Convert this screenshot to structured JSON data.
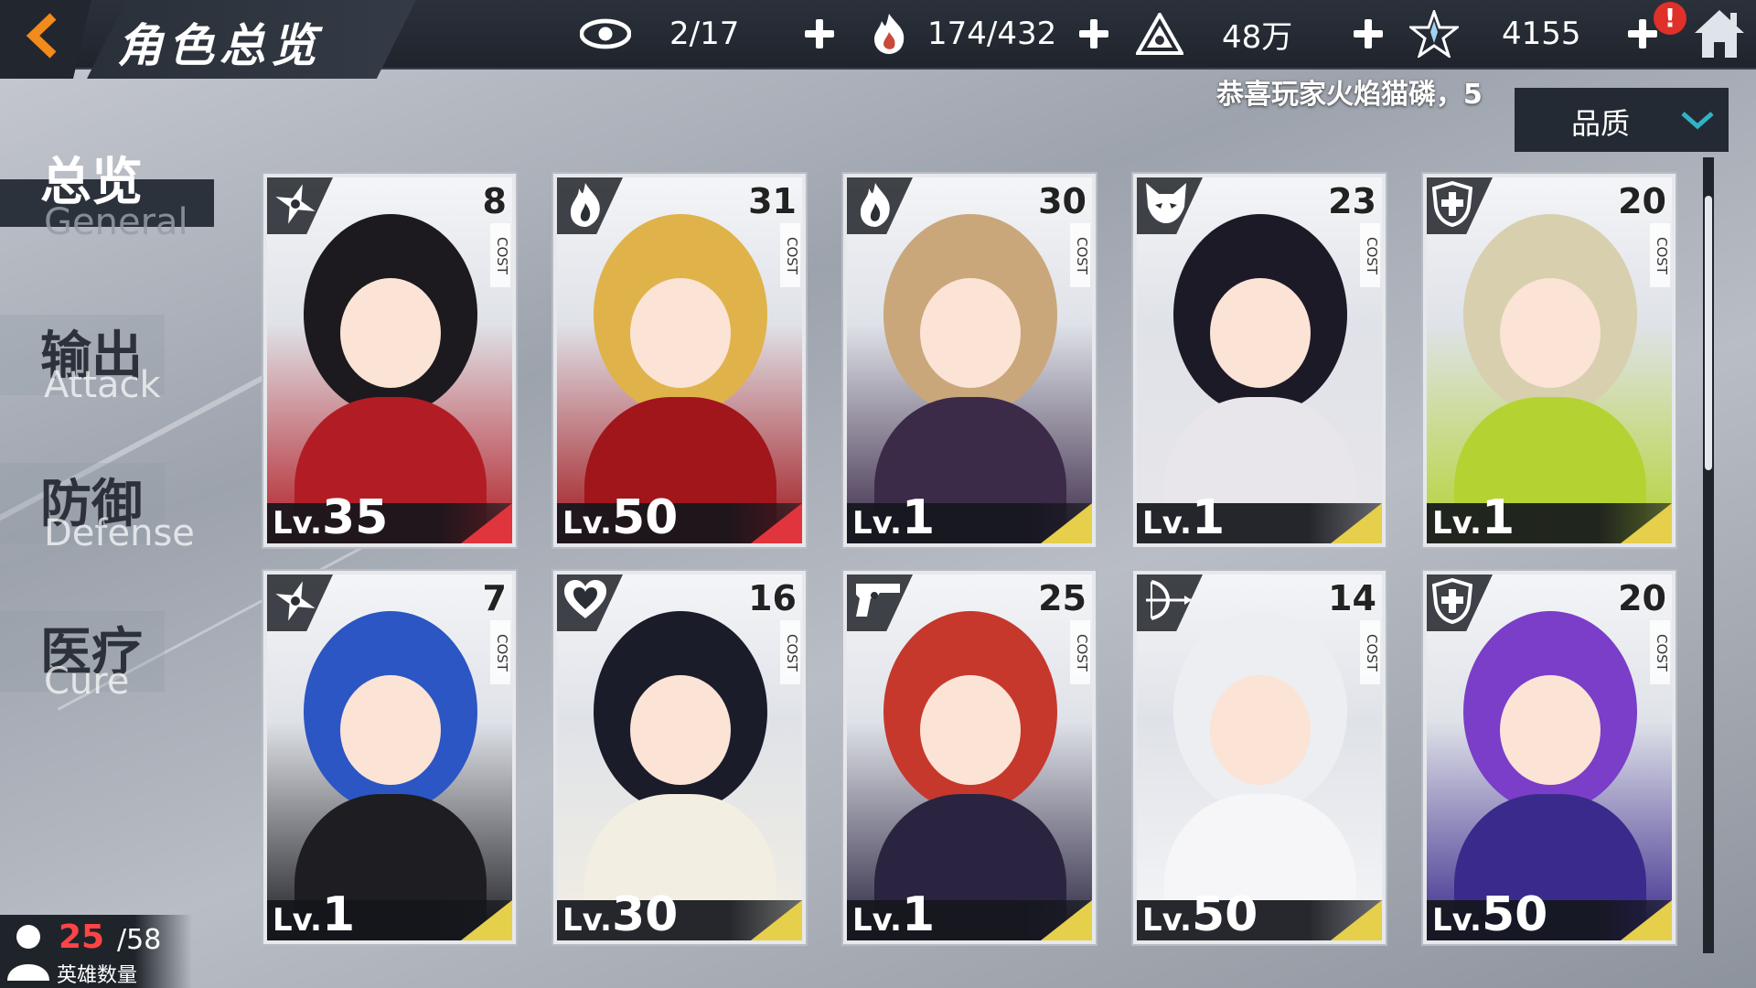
{
  "header": {
    "title": "角色总览",
    "resources": [
      {
        "icon": "eye-icon",
        "value": "2/17"
      },
      {
        "icon": "flame-hand-icon",
        "value": "174/432"
      },
      {
        "icon": "triangle-gem-icon",
        "value": "48万"
      },
      {
        "icon": "star-crystal-icon",
        "value": "4155"
      }
    ],
    "alert_badge": "!"
  },
  "ticker_text": "恭喜玩家火焰猫磷，5",
  "sort": {
    "selected": "品质"
  },
  "sidebar": {
    "items": [
      {
        "cn": "总览",
        "en": "General"
      },
      {
        "cn": "输出",
        "en": "Attack"
      },
      {
        "cn": "防御",
        "en": "Defense"
      },
      {
        "cn": "医疗",
        "en": "Cure"
      }
    ]
  },
  "cards": [
    {
      "cost": "8",
      "cost_label": "COST",
      "lv_prefix": "Lv.",
      "level": "35",
      "class_icon": "shuriken-icon",
      "rarity": "#e0353c",
      "hair": "#1c1a1e",
      "outfit": "#b21d25"
    },
    {
      "cost": "31",
      "cost_label": "COST",
      "lv_prefix": "Lv.",
      "level": "50",
      "class_icon": "flame-icon",
      "rarity": "#e0353c",
      "hair": "#e0b24a",
      "outfit": "#a0161b"
    },
    {
      "cost": "30",
      "cost_label": "COST",
      "lv_prefix": "Lv.",
      "level": "1",
      "class_icon": "flame-icon",
      "rarity": "#e6cf4a",
      "hair": "#c9a77a",
      "outfit": "#3b2a48"
    },
    {
      "cost": "23",
      "cost_label": "COST",
      "lv_prefix": "Lv.",
      "level": "1",
      "class_icon": "fox-mask-icon",
      "rarity": "#e6cf4a",
      "hair": "#1d1a28",
      "outfit": "#e8e6ea"
    },
    {
      "cost": "20",
      "cost_label": "COST",
      "lv_prefix": "Lv.",
      "level": "1",
      "class_icon": "shield-icon",
      "rarity": "#e6cf4a",
      "hair": "#d8cfae",
      "outfit": "#b4d332"
    },
    {
      "cost": "7",
      "cost_label": "COST",
      "lv_prefix": "Lv.",
      "level": "1",
      "class_icon": "shuriken-icon",
      "rarity": "#e6cf4a",
      "hair": "#2b56c4",
      "outfit": "#1d1d22"
    },
    {
      "cost": "16",
      "cost_label": "COST",
      "lv_prefix": "Lv.",
      "level": "30",
      "class_icon": "heart-icon",
      "rarity": "#e6cf4a",
      "hair": "#1a1c2a",
      "outfit": "#f2eee2"
    },
    {
      "cost": "25",
      "cost_label": "COST",
      "lv_prefix": "Lv.",
      "level": "1",
      "class_icon": "pistol-icon",
      "rarity": "#e6cf4a",
      "hair": "#c6382c",
      "outfit": "#2a2440"
    },
    {
      "cost": "14",
      "cost_label": "COST",
      "lv_prefix": "Lv.",
      "level": "50",
      "class_icon": "bow-icon",
      "rarity": "#e6cf4a",
      "hair": "#eceef2",
      "outfit": "#f6f6f8"
    },
    {
      "cost": "20",
      "cost_label": "COST",
      "lv_prefix": "Lv.",
      "level": "50",
      "class_icon": "shield-icon",
      "rarity": "#e6cf4a",
      "hair": "#7a3ec8",
      "outfit": "#3a2a8c"
    }
  ],
  "hero_count": {
    "current": "25",
    "max": "/58",
    "label": "英雄数量"
  }
}
